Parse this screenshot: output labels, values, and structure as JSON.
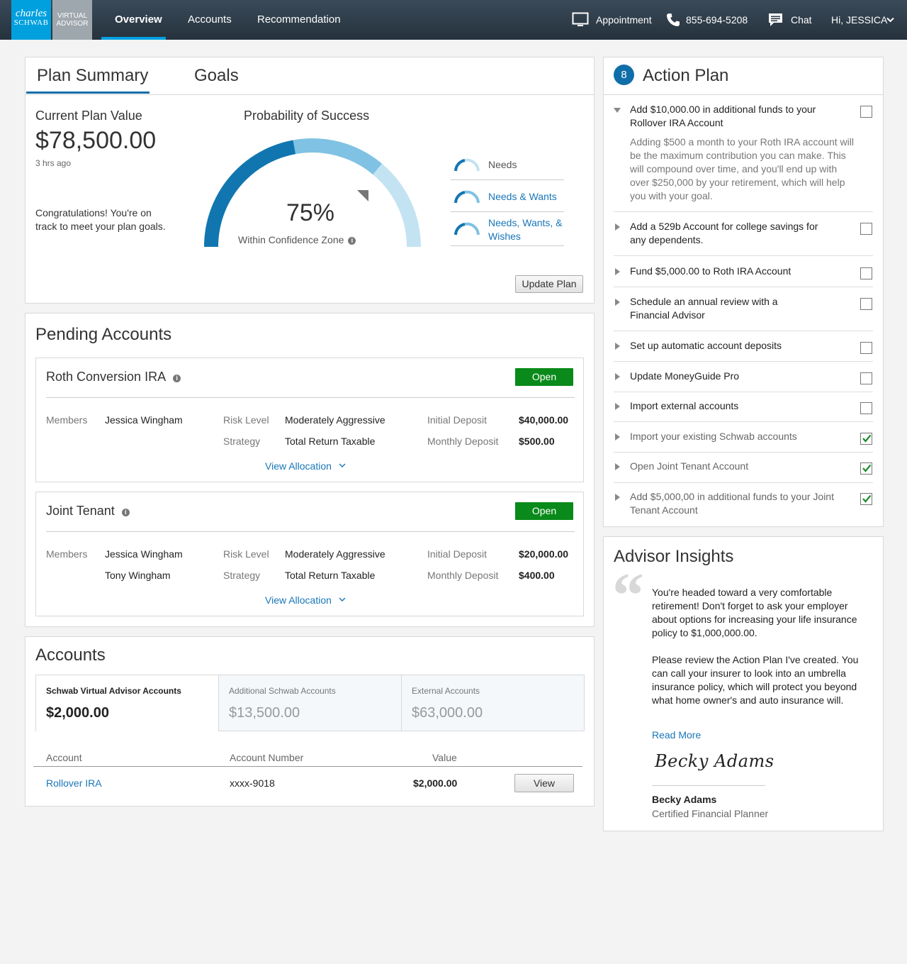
{
  "nav": {
    "logo_line1": "charles",
    "logo_line2": "SCHWAB",
    "logo_va1": "VIRTUAL",
    "logo_va2": "ADVISOR",
    "tabs": [
      {
        "label": "Overview"
      },
      {
        "label": "Accounts"
      },
      {
        "label": "Recommendation"
      }
    ],
    "appointment": "Appointment",
    "phone": "855-694-5208",
    "chat": "Chat",
    "user_greeting": "Hi, JESSICA"
  },
  "plan": {
    "tabs": [
      "Plan Summary",
      "Goals"
    ],
    "current_label": "Current Plan Value",
    "current_value": "$78,500.00",
    "updated": "3 hrs ago",
    "congrats": "Congratulations! You're on track to meet your plan goals.",
    "prob_title": "Probability of Success",
    "percent": "75%",
    "percent_value": 75,
    "confidence": "Within Confidence Zone",
    "legend": [
      "Needs",
      "Needs & Wants",
      "Needs, Wants, & Wishes"
    ],
    "update_button": "Update Plan"
  },
  "pending": {
    "title": "Pending Accounts",
    "labels": {
      "members": "Members",
      "risk": "Risk Level",
      "strategy": "Strategy",
      "initial": "Initial Deposit",
      "monthly": "Monthly Deposit",
      "open": "Open",
      "view_allocation": "View Allocation"
    },
    "accounts": [
      {
        "name": "Roth Conversion IRA",
        "members": [
          "Jessica Wingham"
        ],
        "risk": "Moderately Aggressive",
        "strategy": "Total Return Taxable",
        "initial": "$40,000.00",
        "monthly": "$500.00"
      },
      {
        "name": "Joint Tenant",
        "members": [
          "Jessica Wingham",
          "Tony Wingham"
        ],
        "risk": "Moderately Aggressive",
        "strategy": "Total Return Taxable",
        "initial": "$20,000.00",
        "monthly": "$400.00"
      }
    ]
  },
  "accounts": {
    "title": "Accounts",
    "tabs": [
      {
        "title": "Schwab Virtual Advisor Accounts",
        "value": "$2,000.00"
      },
      {
        "title": "Additional Schwab Accounts",
        "value": "$13,500.00"
      },
      {
        "title": "External Accounts",
        "value": "$63,000.00"
      }
    ],
    "headers": [
      "Account",
      "Account Number",
      "Value"
    ],
    "rows": [
      {
        "account": "Rollover IRA",
        "number": "xxxx-9018",
        "value": "$2,000.00",
        "action": "View"
      }
    ]
  },
  "action_plan": {
    "count": "8",
    "title": "Action Plan",
    "expanded_desc": "Adding $500 a month to your Roth IRA account will be the maximum contribution you can make. This will compound over time, and you'll end up with over $250,000 by your retirement, which will help you with your goal.",
    "items": [
      {
        "text": "Add $10,000.00 in additional funds to your Rollover IRA Account",
        "done": false
      },
      {
        "text": "Add a 529b Account for college savings for any dependents.",
        "done": false
      },
      {
        "text": "Fund $5,000.00 to Roth IRA Account",
        "done": false
      },
      {
        "text": "Schedule an annual review with a Financial Advisor",
        "done": false
      },
      {
        "text": "Set up automatic account deposits",
        "done": false
      },
      {
        "text": "Update MoneyGuide Pro",
        "done": false
      },
      {
        "text": "Import external accounts",
        "done": false
      },
      {
        "text": "Import your existing Schwab accounts",
        "done": true
      },
      {
        "text": "Open Joint Tenant Account",
        "done": true
      },
      {
        "text": "Add $5,000,00 in additional funds to your Joint Tenant Account",
        "done": true
      }
    ]
  },
  "advisor": {
    "title": "Advisor Insights",
    "p1": "You're headed toward a very comfortable retirement! Don't forget to ask your employer about options for increasing your life insurance policy to $1,000,000.00.",
    "p2": "Please review the Action Plan I've created. You can call your insurer to look into an umbrella insurance policy, which will protect you beyond what home owner's and auto insurance will.",
    "read_more": "Read More",
    "signature": "Becky Adams",
    "name": "Becky Adams",
    "role": "Certified Financial Planner"
  },
  "colors": {
    "nav_bg": "#2f3d4a",
    "schwab_blue": "#00a0df",
    "primary": "#0f6ea8",
    "gauge_dark": "#1176b0",
    "gauge_mid": "#7fc2e3",
    "gauge_light": "#c4e3f2",
    "open_green": "#0a8a1a",
    "check_green": "#1a8c2a"
  }
}
